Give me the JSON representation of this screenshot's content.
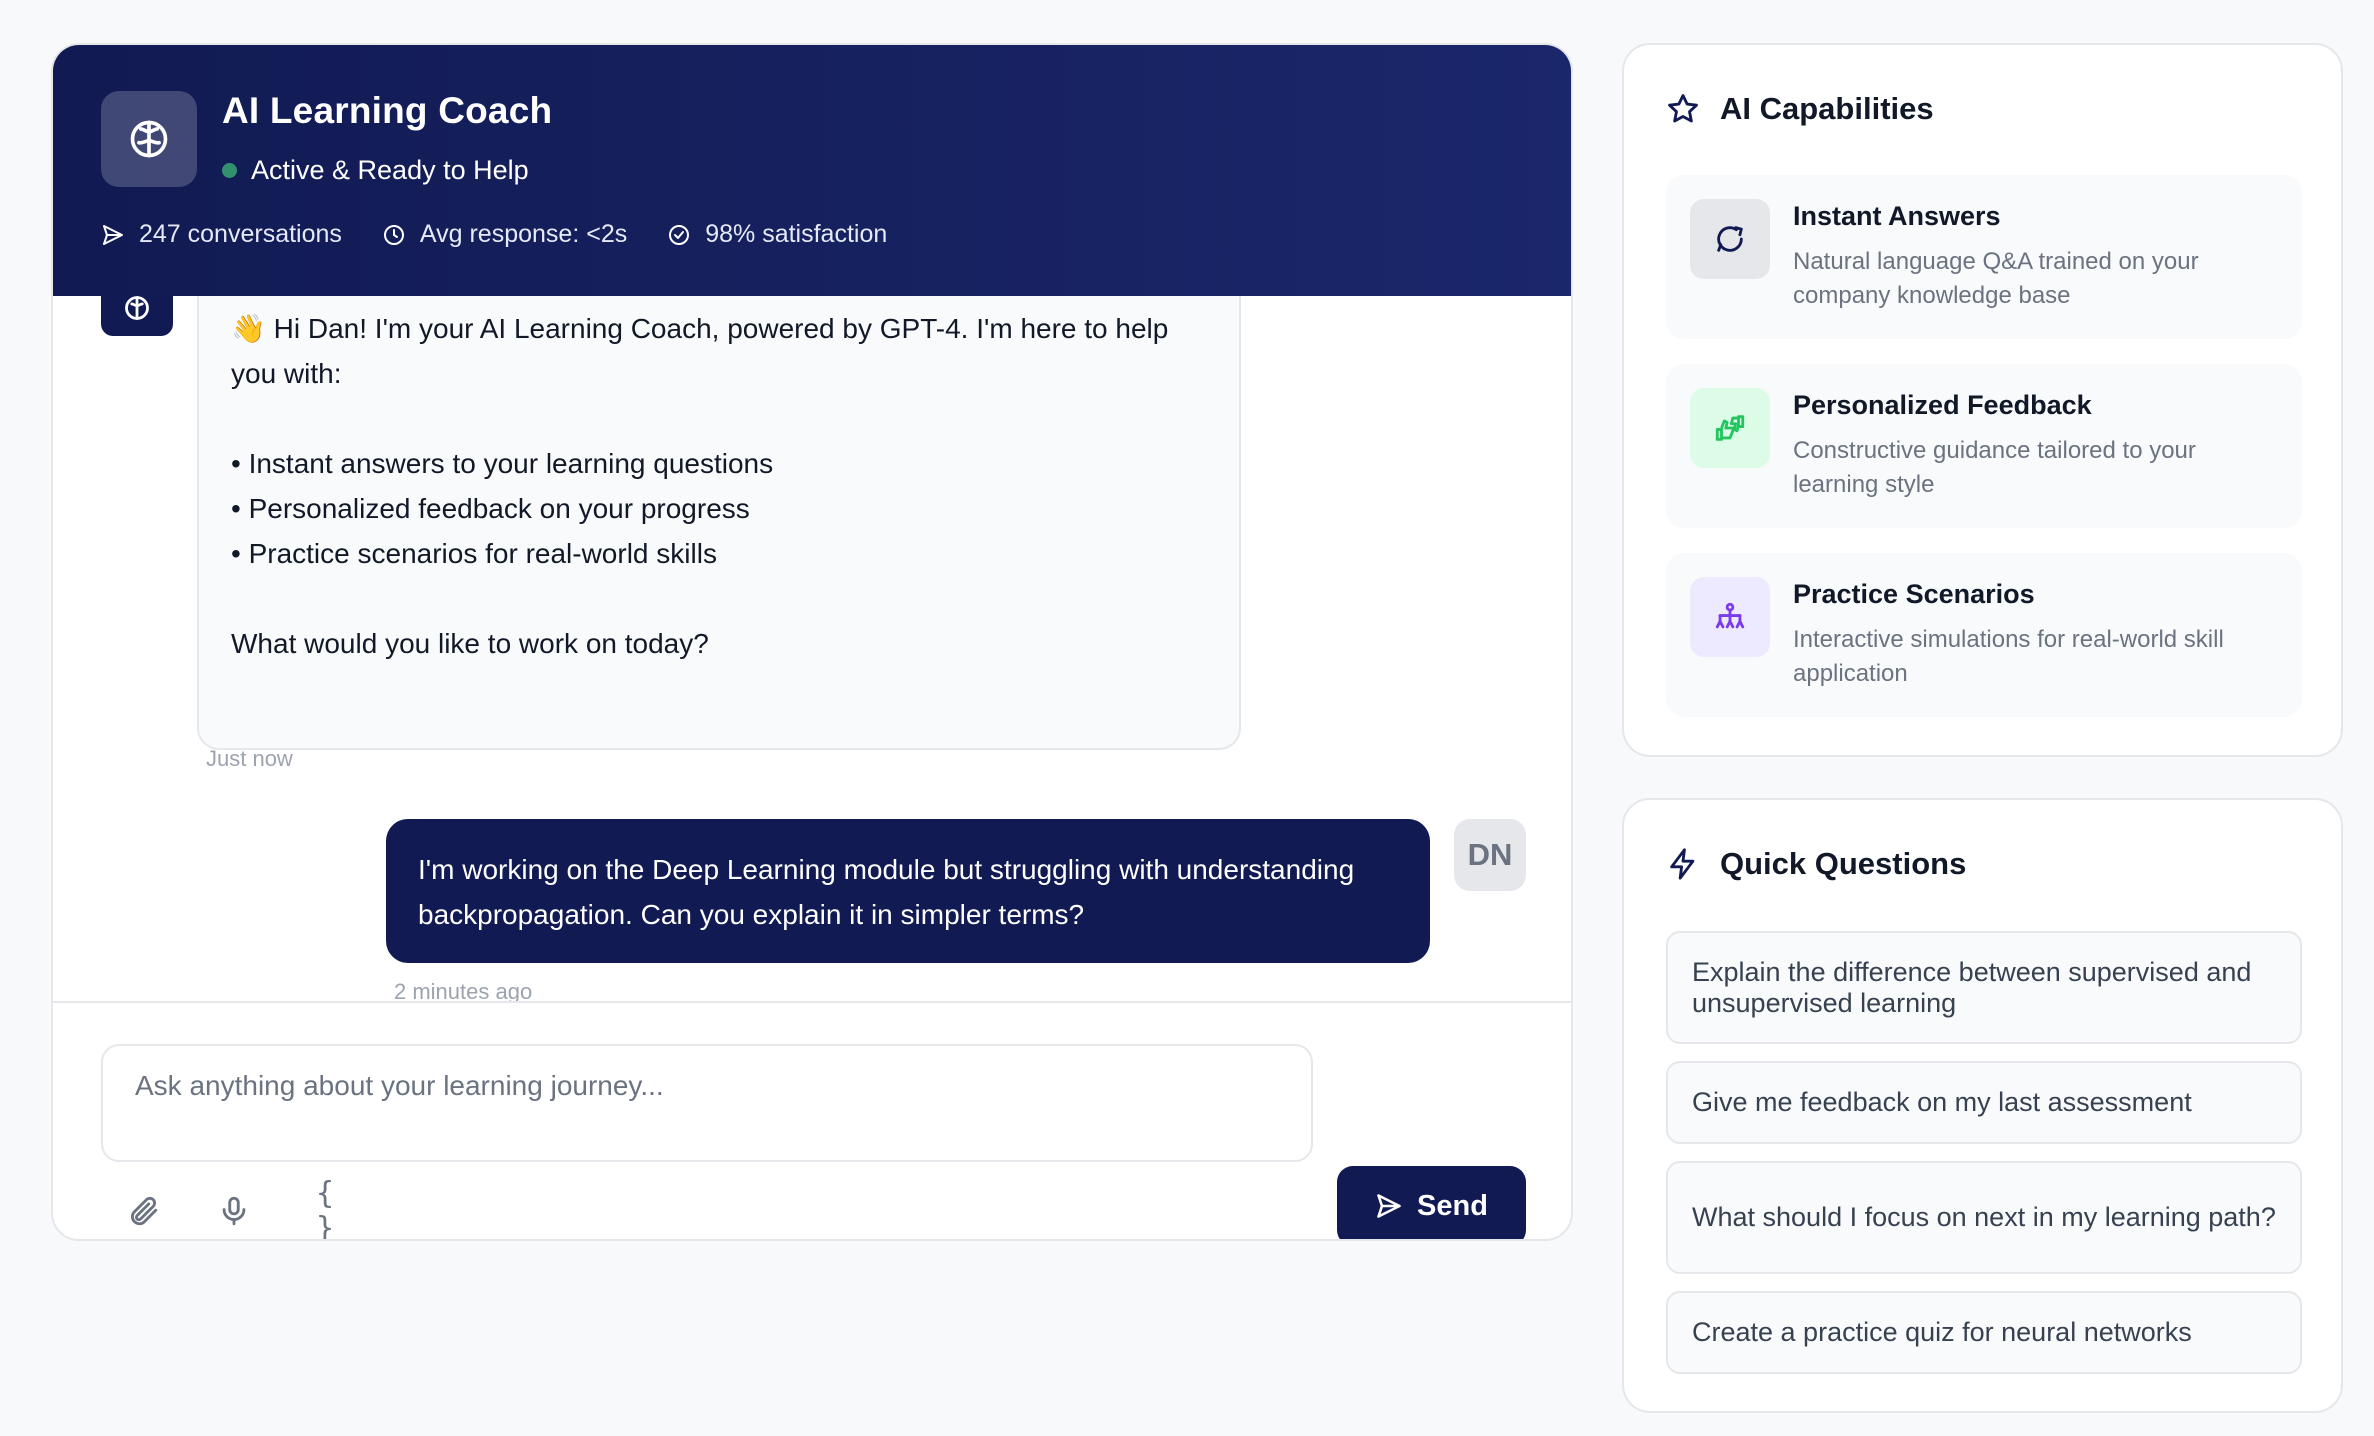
{
  "coach": {
    "title": "AI Learning Coach",
    "status": "Active & Ready to Help",
    "stats": {
      "conversations": "247 conversations",
      "response": "Avg response: <2s",
      "satisfaction": "98% satisfaction"
    }
  },
  "messages": {
    "bot": {
      "greeting": "👋 Hi Dan! I'm your AI Learning Coach, powered by GPT-4. I'm here to help you with:",
      "bullets": [
        "• Instant answers to your learning questions",
        "• Personalized feedback on your progress",
        "• Practice scenarios for real-world skills"
      ],
      "closing": "What would you like to work on today?",
      "time": "Just now"
    },
    "user": {
      "text": "I'm working on the Deep Learning module but struggling with understanding backpropagation. Can you explain it in simpler terms?",
      "initials": "DN",
      "time": "2 minutes ago"
    }
  },
  "composer": {
    "placeholder": "Ask anything about your learning journey...",
    "code_glyph": "{ }",
    "send_label": "Send"
  },
  "capabilities": {
    "title": "AI Capabilities",
    "items": [
      {
        "name": "Instant Answers",
        "desc": "Natural language Q&A trained on your company knowledge base",
        "icon": "chat-bubble-icon",
        "color": "#111a52",
        "bg": "#e5e7eb"
      },
      {
        "name": "Personalized Feedback",
        "desc": "Constructive guidance tailored to your learning style",
        "icon": "thumbs-icon",
        "color": "#22c55e",
        "bg": "#dcfce7"
      },
      {
        "name": "Practice Scenarios",
        "desc": "Interactive simulations for real-world skill application",
        "icon": "network-icon",
        "color": "#7c3aed",
        "bg": "#ede9fe"
      }
    ]
  },
  "quick_questions": {
    "title": "Quick Questions",
    "items": [
      "Explain the difference between supervised and unsupervised learning",
      "Give me feedback on my last assessment",
      "What should I focus on next in my learning path?",
      "Create a practice quiz for neural networks"
    ]
  },
  "colors": {
    "primary": "#111a52",
    "status": "#4ade80",
    "background": "#f8f9fb"
  }
}
